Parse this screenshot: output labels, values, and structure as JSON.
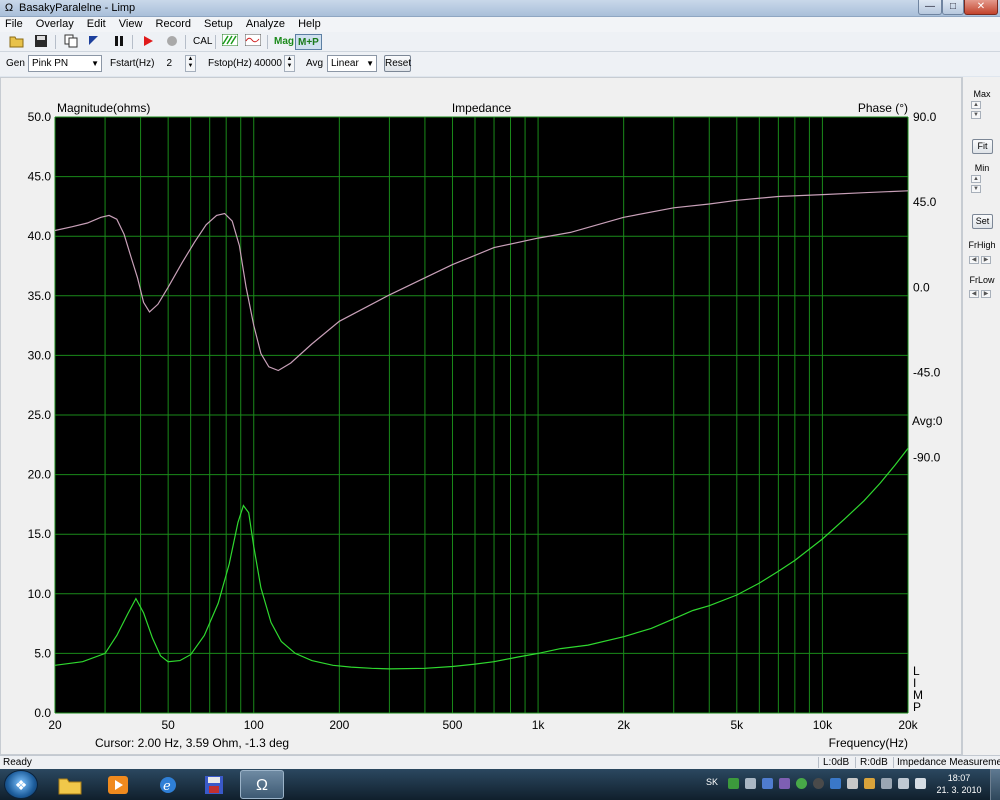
{
  "window": {
    "title": "BasakyParalelne - Limp",
    "app_icon": "Ω"
  },
  "window_controls": {
    "minimize": "—",
    "maximize": "□",
    "close": "✕"
  },
  "menu": [
    "File",
    "Overlay",
    "Edit",
    "View",
    "Record",
    "Setup",
    "Analyze",
    "Help"
  ],
  "toolbar": {
    "icons": [
      "open-folder-icon",
      "save-disk-icon",
      "copy-icon",
      "flag-icon",
      "pause-icon",
      "play-icon",
      "record-icon"
    ],
    "cal_label": "CAL",
    "mag_label": "Mag",
    "mp_label": "M+P"
  },
  "params": {
    "gen_label": "Gen",
    "gen_value": "Pink PN",
    "fstart_label": "Fstart(Hz)",
    "fstart_value": "2",
    "fstop_label": "Fstop(Hz)",
    "fstop_value": "40000",
    "avg_label": "Avg",
    "avg_value": "Linear",
    "reset_label": "Reset"
  },
  "right_panel": {
    "max_label": "Max",
    "fit_label": "Fit",
    "min_label": "Min",
    "set_label": "Set",
    "frhigh_label": "FrHigh",
    "frlow_label": "FrLow"
  },
  "chart_data": {
    "type": "line",
    "title": "Impedance",
    "ylabel": "Magnitude(ohms)",
    "y2label": "Phase (°)",
    "xlabel": "Frequency(Hz)",
    "x_scale": "log",
    "xlim": [
      20,
      20000
    ],
    "ylim": [
      0,
      50
    ],
    "y2lim": [
      -225,
      90
    ],
    "yticks": [
      "50.0",
      "45.0",
      "40.0",
      "35.0",
      "30.0",
      "25.0",
      "20.0",
      "15.0",
      "10.0",
      "5.0",
      "0.0"
    ],
    "y2ticks": [
      "90.0",
      "45.0",
      "0.0",
      "-45.0",
      "-90.0"
    ],
    "xticks": [
      {
        "v": 20,
        "label": "20"
      },
      {
        "v": 50,
        "label": "50"
      },
      {
        "v": 100,
        "label": "100"
      },
      {
        "v": 200,
        "label": "200"
      },
      {
        "v": 500,
        "label": "500"
      },
      {
        "v": 1000,
        "label": "1k"
      },
      {
        "v": 2000,
        "label": "2k"
      },
      {
        "v": 5000,
        "label": "5k"
      },
      {
        "v": 10000,
        "label": "10k"
      },
      {
        "v": 20000,
        "label": "20k"
      }
    ],
    "avg_label": "Avg:0",
    "limp_label": [
      "L",
      "I",
      "M",
      "P"
    ],
    "cursor_text": "Cursor: 2.00 Hz, 3.59 Ohm, -1.3 deg",
    "grid": true,
    "background": "#000000",
    "grid_color": "#1a8a1a",
    "series": [
      {
        "axis": "magnitude",
        "color": "#2fd82f",
        "points": [
          [
            20,
            4.0
          ],
          [
            25,
            4.3
          ],
          [
            30,
            5.0
          ],
          [
            33,
            6.5
          ],
          [
            36,
            8.3
          ],
          [
            38.5,
            9.6
          ],
          [
            41,
            8.4
          ],
          [
            44,
            6.3
          ],
          [
            47,
            4.8
          ],
          [
            50,
            4.3
          ],
          [
            55,
            4.4
          ],
          [
            60,
            4.9
          ],
          [
            67,
            6.5
          ],
          [
            75,
            9.2
          ],
          [
            82,
            12.5
          ],
          [
            88,
            16.0
          ],
          [
            92,
            17.4
          ],
          [
            96,
            16.8
          ],
          [
            100,
            14.0
          ],
          [
            106,
            10.5
          ],
          [
            115,
            7.6
          ],
          [
            125,
            6.0
          ],
          [
            140,
            5.0
          ],
          [
            160,
            4.4
          ],
          [
            190,
            4.0
          ],
          [
            220,
            3.85
          ],
          [
            260,
            3.75
          ],
          [
            300,
            3.7
          ],
          [
            400,
            3.75
          ],
          [
            500,
            3.9
          ],
          [
            600,
            4.1
          ],
          [
            700,
            4.3
          ],
          [
            850,
            4.7
          ],
          [
            1000,
            5.0
          ],
          [
            1200,
            5.4
          ],
          [
            1500,
            5.7
          ],
          [
            2000,
            6.4
          ],
          [
            2500,
            7.1
          ],
          [
            3000,
            7.9
          ],
          [
            3500,
            8.6
          ],
          [
            4000,
            9.0
          ],
          [
            5000,
            9.9
          ],
          [
            6000,
            10.9
          ],
          [
            7000,
            11.9
          ],
          [
            8000,
            12.8
          ],
          [
            10000,
            14.6
          ],
          [
            12000,
            16.3
          ],
          [
            14000,
            17.8
          ],
          [
            16000,
            19.3
          ],
          [
            18000,
            20.8
          ],
          [
            20000,
            22.2
          ]
        ]
      },
      {
        "axis": "phase",
        "color": "#c8a0b8",
        "points": [
          [
            20,
            30
          ],
          [
            23,
            32
          ],
          [
            26,
            34
          ],
          [
            29,
            37
          ],
          [
            31,
            38
          ],
          [
            33,
            36
          ],
          [
            35,
            28
          ],
          [
            37,
            16
          ],
          [
            39,
            5
          ],
          [
            41,
            -8
          ],
          [
            43,
            -13
          ],
          [
            46,
            -9
          ],
          [
            50,
            0
          ],
          [
            56,
            13
          ],
          [
            62,
            24
          ],
          [
            68,
            33
          ],
          [
            74,
            38
          ],
          [
            79,
            39
          ],
          [
            84,
            35
          ],
          [
            89,
            22
          ],
          [
            94,
            0
          ],
          [
            100,
            -20
          ],
          [
            106,
            -35
          ],
          [
            113,
            -42
          ],
          [
            122,
            -44
          ],
          [
            135,
            -40
          ],
          [
            160,
            -30
          ],
          [
            200,
            -18
          ],
          [
            300,
            -4
          ],
          [
            400,
            5
          ],
          [
            500,
            12
          ],
          [
            700,
            21
          ],
          [
            1000,
            26
          ],
          [
            1300,
            29
          ],
          [
            2000,
            37
          ],
          [
            3000,
            42
          ],
          [
            4000,
            44
          ],
          [
            5000,
            46
          ],
          [
            7000,
            48
          ],
          [
            10000,
            49
          ],
          [
            14000,
            50
          ],
          [
            20000,
            51
          ]
        ]
      }
    ]
  },
  "status": {
    "ready": "Ready",
    "l_level": "L:0dB",
    "r_level": "R:0dB",
    "mode": "Impedance Measuremen"
  },
  "taskbar": {
    "apps": [
      "folder-icon",
      "media-player-icon",
      "ie-icon",
      "save-icon",
      "limp-icon"
    ],
    "lang": "SK",
    "time": "18:07",
    "date": "21. 3. 2010"
  }
}
